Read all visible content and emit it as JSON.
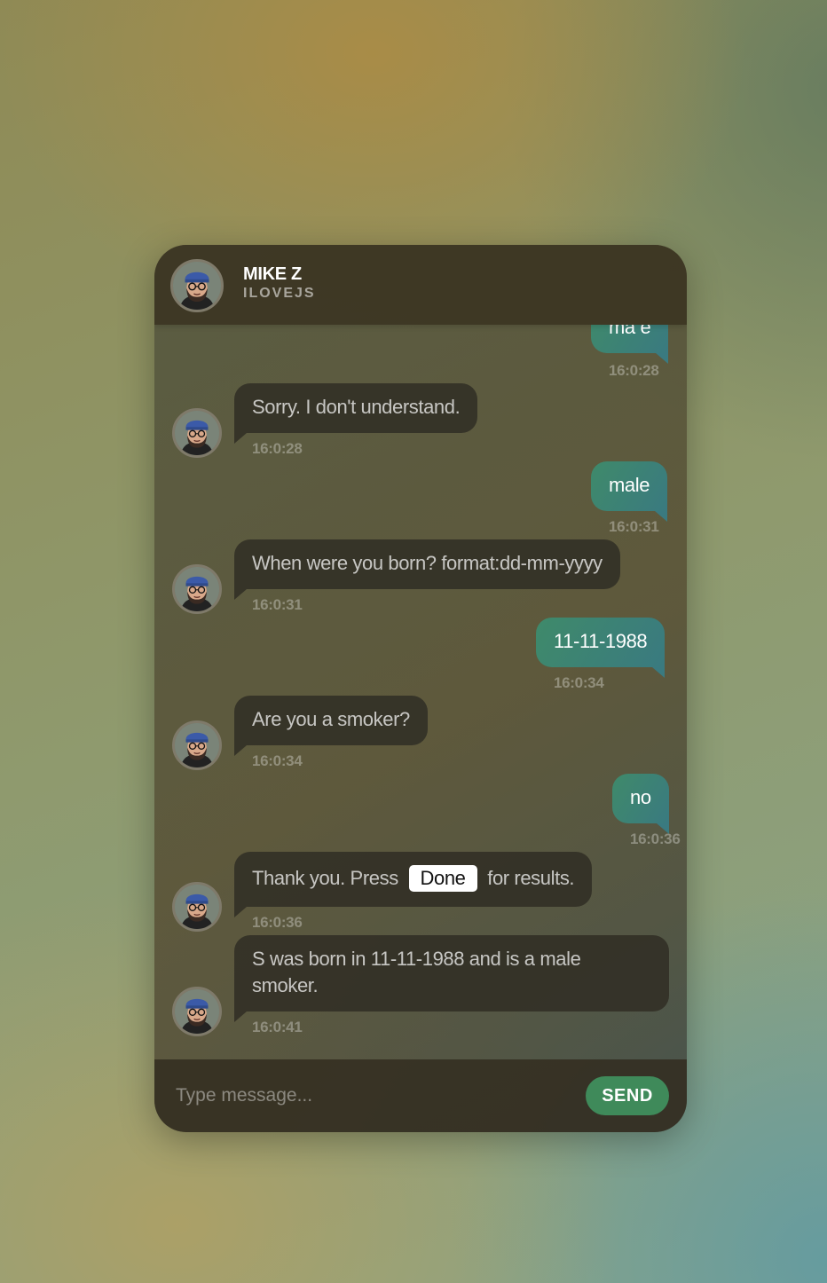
{
  "header": {
    "name": "MIKE Z",
    "subtitle": "ILOVEJS"
  },
  "messages": [
    {
      "from": "user",
      "text": "ma e",
      "time": "16:0:28"
    },
    {
      "from": "bot",
      "text": "Sorry. I don't understand.",
      "time": "16:0:28"
    },
    {
      "from": "user",
      "text": "male",
      "time": "16:0:31"
    },
    {
      "from": "bot",
      "text": "When were you born? format:dd-mm-yyyy",
      "time": "16:0:31"
    },
    {
      "from": "user",
      "text": "11-11-1988",
      "time": "16:0:34"
    },
    {
      "from": "bot",
      "text": "Are you a smoker?",
      "time": "16:0:34"
    },
    {
      "from": "user",
      "text": "no",
      "time": "16:0:36"
    },
    {
      "from": "bot",
      "text_before": "Thank you. Press",
      "button": "Done",
      "text_after": "for results.",
      "time": "16:0:36"
    },
    {
      "from": "bot",
      "text": "S was born in 11-11-1988 and is a male smoker.",
      "time": "16:0:41"
    }
  ],
  "composer": {
    "placeholder": "Type message...",
    "send_label": "SEND"
  },
  "colors": {
    "outgoing_bubble": "#3f8a6a",
    "send_button": "#3f8a5a",
    "incoming_bubble": "#32302a"
  },
  "icons": {
    "avatar": "avatar-icon"
  }
}
